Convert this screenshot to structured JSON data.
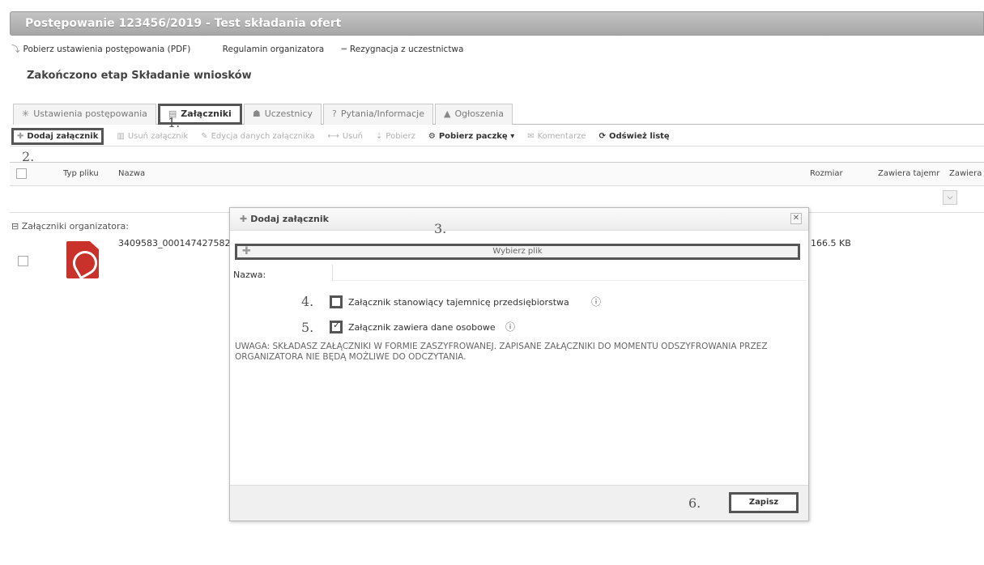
{
  "header": {
    "title": "Postępowanie 123456/2019 - Test składania ofert"
  },
  "links": [
    {
      "label": "Pobierz ustawienia postępowania (PDF)"
    },
    {
      "label": "Regulamin organizatora"
    },
    {
      "label": "Rezygnacja z uczestnictwa"
    }
  ],
  "stage": "Zakończono etap Składanie wniosków",
  "tabs": [
    {
      "label": "Ustawienia postępowania"
    },
    {
      "label": "Załączniki"
    },
    {
      "label": "Uczestnicy"
    },
    {
      "label": "Pytania/Informacje"
    },
    {
      "label": "Ogłoszenia"
    }
  ],
  "toolbar": {
    "add": "Dodaj załącznik",
    "delete": "Usuń załącznik",
    "edit": "Edycja danych załącznika",
    "remove": "Usuń",
    "download": "Pobierz",
    "package": "Pobierz paczkę ▾",
    "comments": "Komentarze",
    "refresh": "Odśwież listę"
  },
  "steps": {
    "s1": "1.",
    "s2": "2.",
    "s3": "3.",
    "s4": "4.",
    "s5": "5.",
    "s6": "6."
  },
  "grid": {
    "headers": {
      "type": "Typ pliku",
      "name": "Nazwa",
      "size": "Rozmiar",
      "secret": "Zawiera tajemr",
      "other": "Zawiera"
    },
    "group": "Załączniki organizatora:",
    "rows": [
      {
        "name": "3409583_000147427582",
        "size": "166.5 KB"
      }
    ]
  },
  "dialog": {
    "title": "Dodaj załącznik",
    "choose_file": "Wybierz plik",
    "name_label": "Nazwa:",
    "cb_secret": "Załącznik stanowiący tajemnicę przedsiębiorstwa",
    "cb_personal": "Załącznik zawiera dane osobowe",
    "warning": "UWAGA: SKŁADASZ ZAŁĄCZNIKI W FORMIE ZASZYFROWANEJ. ZAPISANE ZAŁĄCZNIKI DO MOMENTU ODSZYFROWANIA PRZEZ ORGANIZATORA NIE BĘDĄ MOŻLIWE DO ODCZYTANIA.",
    "save": "Zapisz",
    "cb_secret_checked": false,
    "cb_personal_checked": true
  }
}
